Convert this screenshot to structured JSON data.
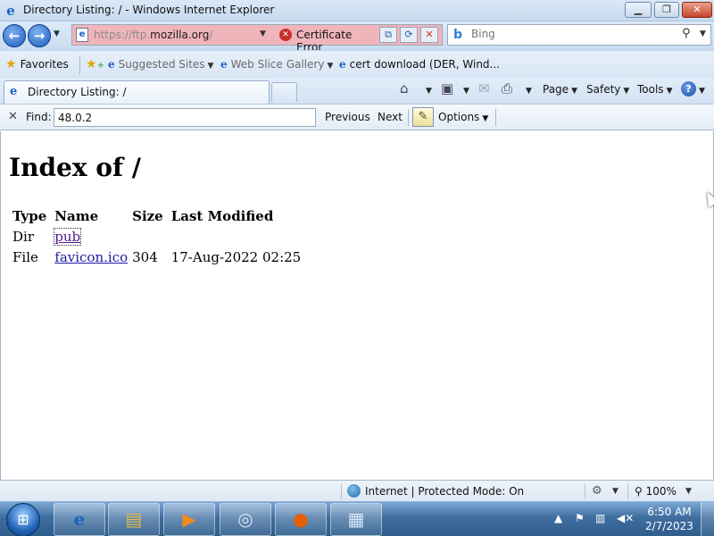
{
  "window": {
    "title": "Directory Listing: / - Windows Internet Explorer",
    "minimize_label": "▁",
    "maximize_label": "❐",
    "close_label": "✕"
  },
  "nav": {
    "back_glyph": "←",
    "forward_glyph": "→",
    "address_scheme_path_prefix": "https://ftp.",
    "address_host": "mozilla.org",
    "address_suffix": "/",
    "certificate_error": "Certificate Error",
    "search_placeholder": "Bing"
  },
  "favorites_bar": {
    "favorites_label": "Favorites",
    "items": [
      {
        "label": "Suggested Sites",
        "has_dropdown": true
      },
      {
        "label": "Web Slice Gallery",
        "has_dropdown": true
      },
      {
        "label": "cert download (DER, Wind...",
        "has_dropdown": false
      }
    ]
  },
  "tab": {
    "title": "Directory Listing: /"
  },
  "commands": {
    "page": "Page",
    "safety": "Safety",
    "tools": "Tools",
    "help": "?"
  },
  "find": {
    "label": "Find:",
    "value": "48.0.2",
    "previous": "Previous",
    "next": "Next",
    "options": "Options"
  },
  "page": {
    "heading": "Index of /",
    "columns": [
      "Type",
      "Name",
      "Size",
      "Last Modified"
    ],
    "rows": [
      {
        "type": "Dir",
        "name": "pub",
        "size": "",
        "modified": ""
      },
      {
        "type": "File",
        "name": "favicon.ico",
        "size": "304",
        "modified": "17-Aug-2022 02:25"
      }
    ]
  },
  "status": {
    "zone": "Internet | Protected Mode: On",
    "zoom": "100%"
  },
  "taskbar": {
    "apps": [
      "internet-explorer",
      "windows-explorer",
      "media-center",
      "dvd-maker",
      "firefox",
      "remote-desktop"
    ],
    "time": "6:50 AM",
    "date": "2/7/2023"
  },
  "colors": {
    "address_error_bg": "#f0b5bb",
    "link": "#1a1aa6",
    "visited_link": "#551a8b",
    "chrome_blue": "#cadcf1"
  }
}
